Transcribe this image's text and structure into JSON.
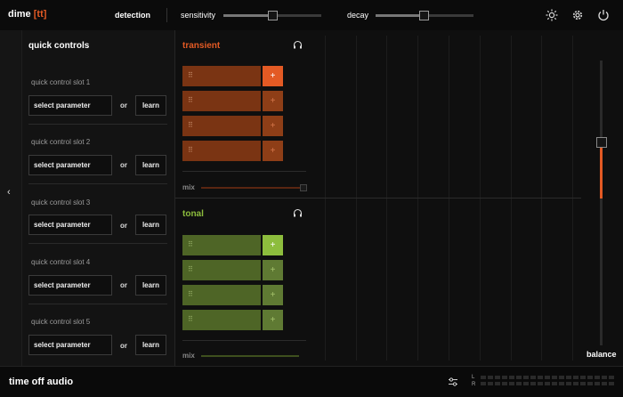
{
  "header": {
    "brand": "dime",
    "brand_bracket": "[tt]",
    "detection_label": "detection",
    "sensitivity_label": "sensitivity",
    "sensitivity_value": 0.5,
    "decay_label": "decay",
    "decay_value": 0.4,
    "icons": [
      "sun-icon",
      "gear-icon",
      "power-icon"
    ]
  },
  "quick_controls": {
    "title": "quick controls",
    "slots": [
      {
        "label": "quick control slot 1",
        "select": "select parameter",
        "or": "or",
        "learn": "learn"
      },
      {
        "label": "quick control slot 2",
        "select": "select parameter",
        "or": "or",
        "learn": "learn"
      },
      {
        "label": "quick control slot 3",
        "select": "select parameter",
        "or": "or",
        "learn": "learn"
      },
      {
        "label": "quick control slot 4",
        "select": "select parameter",
        "or": "or",
        "learn": "learn"
      },
      {
        "label": "quick control slot 5",
        "select": "select parameter",
        "or": "or",
        "learn": "learn"
      }
    ]
  },
  "transient": {
    "title": "transient",
    "color": "#e35a24",
    "rows": 4,
    "mix_label": "mix"
  },
  "tonal": {
    "title": "tonal",
    "color": "#8dbd3d",
    "rows": 4,
    "mix_label": "mix"
  },
  "balance": {
    "label": "balance"
  },
  "footer": {
    "company": "time off audio",
    "meter_left": "L",
    "meter_right": "R"
  }
}
